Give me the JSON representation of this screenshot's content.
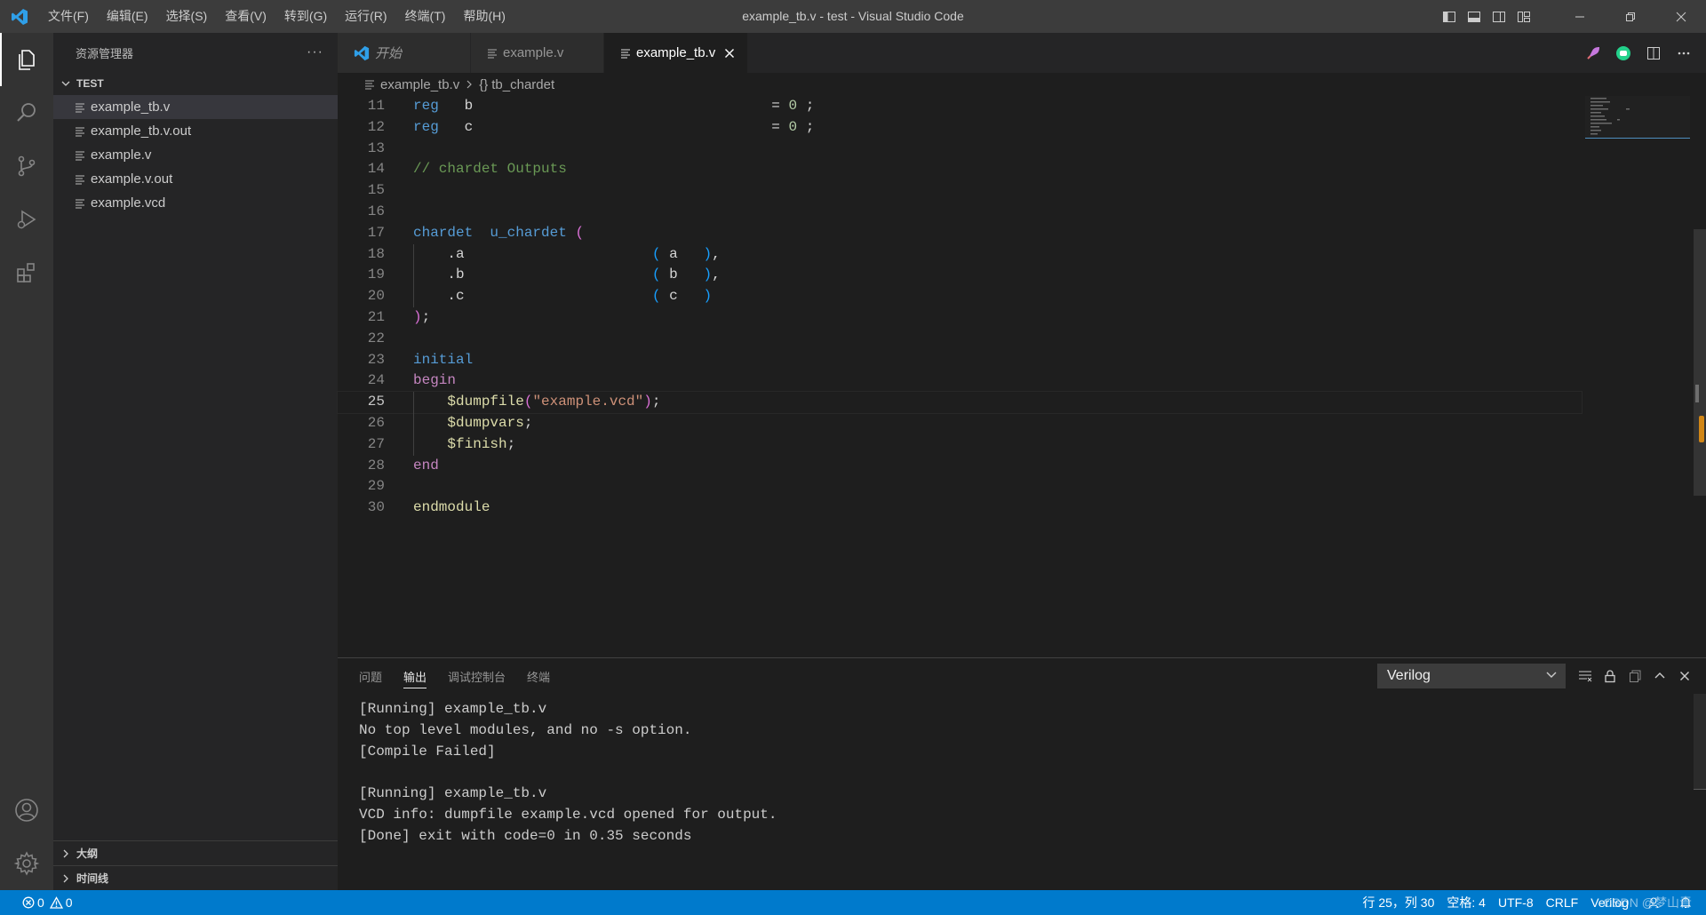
{
  "titlebar": {
    "menu": [
      "文件(F)",
      "编辑(E)",
      "选择(S)",
      "查看(V)",
      "转到(G)",
      "运行(R)",
      "终端(T)",
      "帮助(H)"
    ],
    "title": "example_tb.v - test - Visual Studio Code"
  },
  "sidebar": {
    "header": "资源管理器",
    "more": "···",
    "folder": "TEST",
    "files": [
      "example_tb.v",
      "example_tb.v.out",
      "example.v",
      "example.v.out",
      "example.vcd"
    ],
    "selected_file": "example_tb.v",
    "outline": "大纲",
    "timeline": "时间线"
  },
  "tabs": [
    {
      "label": "开始",
      "active": false,
      "italic": true
    },
    {
      "label": "example.v",
      "active": false
    },
    {
      "label": "example_tb.v",
      "active": true
    }
  ],
  "breadcrumb": {
    "file": "example_tb.v",
    "symbol": "tb_chardet"
  },
  "code_lines": [
    {
      "n": "11",
      "html": "<span class='k'>reg</span>   <span class='id'>b</span>                                   <span class='w'>= </span><span class='n'>0</span><span class='w'> ;</span>"
    },
    {
      "n": "12",
      "html": "<span class='k'>reg</span>   <span class='id'>c</span>                                   <span class='w'>= </span><span class='n'>0</span><span class='w'> ;</span>"
    },
    {
      "n": "13",
      "html": ""
    },
    {
      "n": "14",
      "html": "<span class='c'>// chardet Outputs</span>"
    },
    {
      "n": "15",
      "html": ""
    },
    {
      "n": "16",
      "html": ""
    },
    {
      "n": "17",
      "html": "<span class='k'>chardet</span>  <span class='k'>u_chardet</span> <span class='pk'>(</span>"
    },
    {
      "n": "18",
      "html": "    <span class='w'>.a</span>                      <span class='bl'>(</span> <span class='id'>a</span>   <span class='bl'>)</span><span class='w'>,</span>",
      "guide": true
    },
    {
      "n": "19",
      "html": "    <span class='w'>.b</span>                      <span class='bl'>(</span> <span class='id'>b</span>   <span class='bl'>)</span><span class='w'>,</span>",
      "guide": true
    },
    {
      "n": "20",
      "html": "    <span class='w'>.c</span>                      <span class='bl'>(</span> <span class='id'>c</span>   <span class='bl'>)</span>",
      "guide": true
    },
    {
      "n": "21",
      "html": "<span class='pk'>)</span><span class='w'>;</span>"
    },
    {
      "n": "22",
      "html": ""
    },
    {
      "n": "23",
      "html": "<span class='k'>initial</span>"
    },
    {
      "n": "24",
      "html": "<span class='m'>begin</span>"
    },
    {
      "n": "25",
      "html": "    <span class='y'>$dumpfile</span><span class='pk'>(</span><span class='s'>\"example.vcd\"</span><span class='pk'>)</span><span class='w'>;</span>",
      "guide": true,
      "current": true
    },
    {
      "n": "26",
      "html": "    <span class='y'>$dumpvars</span><span class='w'>;</span>",
      "guide": true
    },
    {
      "n": "27",
      "html": "    <span class='y'>$finish</span><span class='w'>;</span>",
      "guide": true
    },
    {
      "n": "28",
      "html": "<span class='m'>end</span>"
    },
    {
      "n": "29",
      "html": ""
    },
    {
      "n": "30",
      "html": "<span class='y'>endmodule</span>"
    }
  ],
  "panel": {
    "tabs": [
      "问题",
      "输出",
      "调试控制台",
      "终端"
    ],
    "active_tab": "输出",
    "channel": "Verilog",
    "output_lines": [
      "[Running] example_tb.v",
      "No top level modules, and no -s option.",
      "[Compile Failed]",
      "",
      "[Running] example_tb.v",
      "VCD info: dumpfile example.vcd opened for output.",
      "[Done] exit with code=0 in 0.35 seconds"
    ]
  },
  "statusbar": {
    "errors": "0",
    "warnings": "0",
    "position": "行 25，列 30",
    "spaces": "空格: 4",
    "encoding": "UTF-8",
    "eol": "CRLF",
    "language": "Verilog",
    "watermark": "CSDN @梦山青"
  },
  "colors": {
    "accent": "#007acc",
    "titlebar": "#3c3c3c",
    "activitybar": "#333333",
    "sidebar": "#252526",
    "editor": "#1e1e1e"
  }
}
